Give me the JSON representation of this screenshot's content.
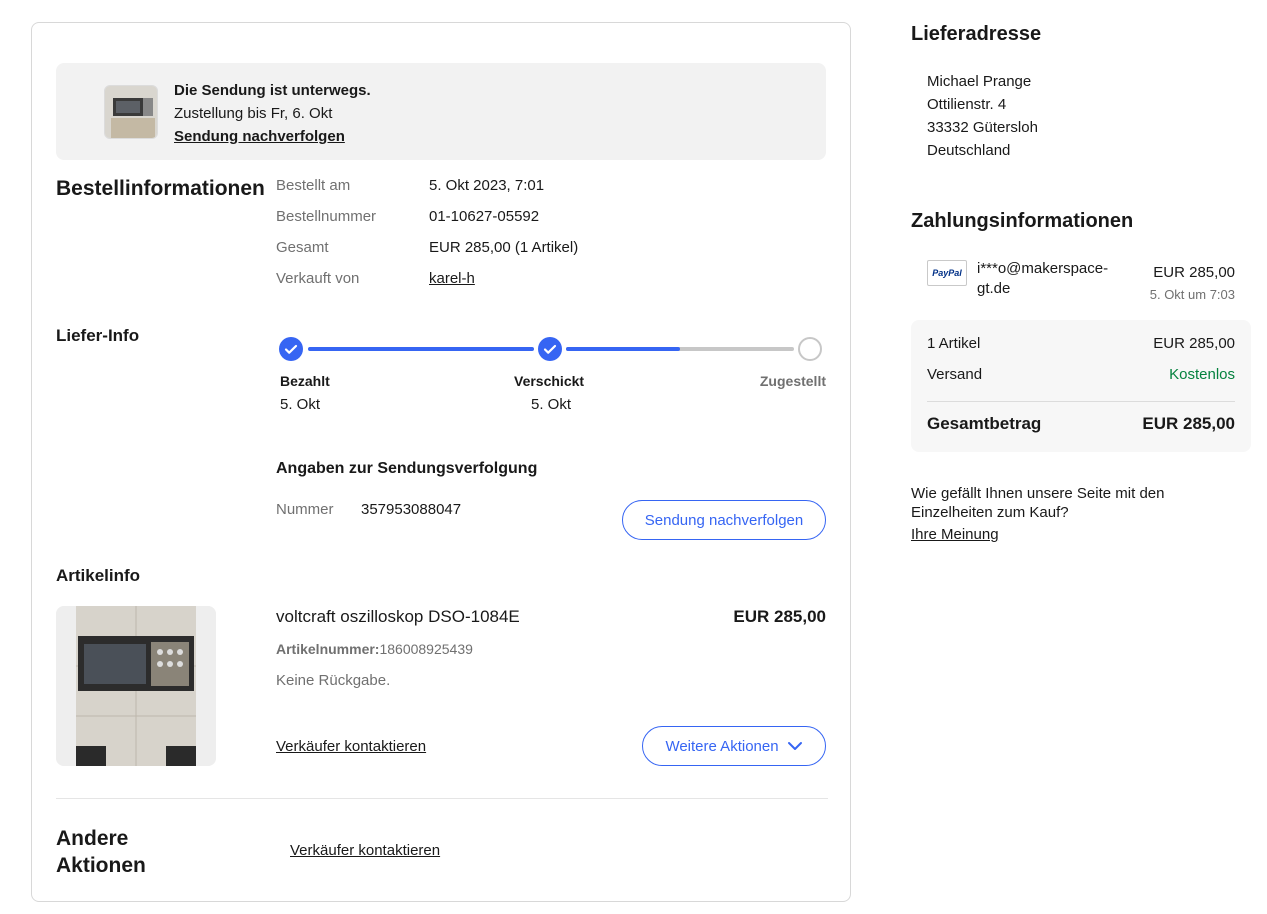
{
  "shipment": {
    "status_title": "Die Sendung ist unterwegs.",
    "delivery_text": "Zustellung bis Fr, 6. Okt",
    "track_link": "Sendung nachverfolgen"
  },
  "order_info": {
    "heading": "Bestellinformationen",
    "rows": [
      {
        "label": "Bestellt am",
        "value": "5. Okt 2023, 7:01"
      },
      {
        "label": "Bestellnummer",
        "value": "01-10627-05592"
      },
      {
        "label": "Gesamt",
        "value": "EUR 285,00 (1 Artikel)"
      },
      {
        "label": "Verkauft von",
        "value": "karel-h"
      }
    ]
  },
  "delivery_info": {
    "heading": "Liefer-Info",
    "progress_fraction": 0.75,
    "steps": [
      {
        "label": "Bezahlt",
        "date": "5. Okt",
        "status": "done"
      },
      {
        "label": "Verschickt",
        "date": "5. Okt",
        "status": "done"
      },
      {
        "label": "Zugestellt",
        "date": "",
        "status": "pending"
      }
    ],
    "tracking_heading": "Angaben zur Sendungsverfolgung",
    "tracking_label": "Nummer",
    "tracking_number": "357953088047",
    "track_button": "Sendung nachverfolgen"
  },
  "item_info": {
    "heading": "Artikelinfo",
    "title": "voltcraft oszilloskop DSO-1084E",
    "price": "EUR 285,00",
    "item_number_label": "Artikelnummer:",
    "item_number": "186008925439",
    "return_policy": "Keine Rückgabe.",
    "contact_seller": "Verkäufer kontaktieren",
    "more_actions": "Weitere Aktionen"
  },
  "other_actions": {
    "heading_line1": "Andere",
    "heading_line2": "Aktionen",
    "contact_seller": "Verkäufer kontaktieren"
  },
  "address": {
    "heading": "Lieferadresse",
    "lines": [
      "Michael Prange",
      "Ottilienstr. 4",
      "33332 Gütersloh",
      "Deutschland"
    ]
  },
  "payment": {
    "heading": "Zahlungsinformationen",
    "method_logo": "PayPal",
    "email_line1": "i***o@makerspace-",
    "email_line2": "gt.de",
    "amount": "EUR 285,00",
    "date": "5. Okt um 7:03",
    "summary": {
      "items_label": "1 Artikel",
      "items_value": "EUR 285,00",
      "shipping_label": "Versand",
      "shipping_value": "Kostenlos",
      "total_label": "Gesamtbetrag",
      "total_value": "EUR 285,00"
    }
  },
  "feedback": {
    "question_line1": "Wie gefällt Ihnen unsere Seite mit den",
    "question_line2": "Einzelheiten zum Kauf?",
    "link": "Ihre Meinung"
  },
  "colors": {
    "accent": "#3665f3",
    "success": "#05823f"
  }
}
